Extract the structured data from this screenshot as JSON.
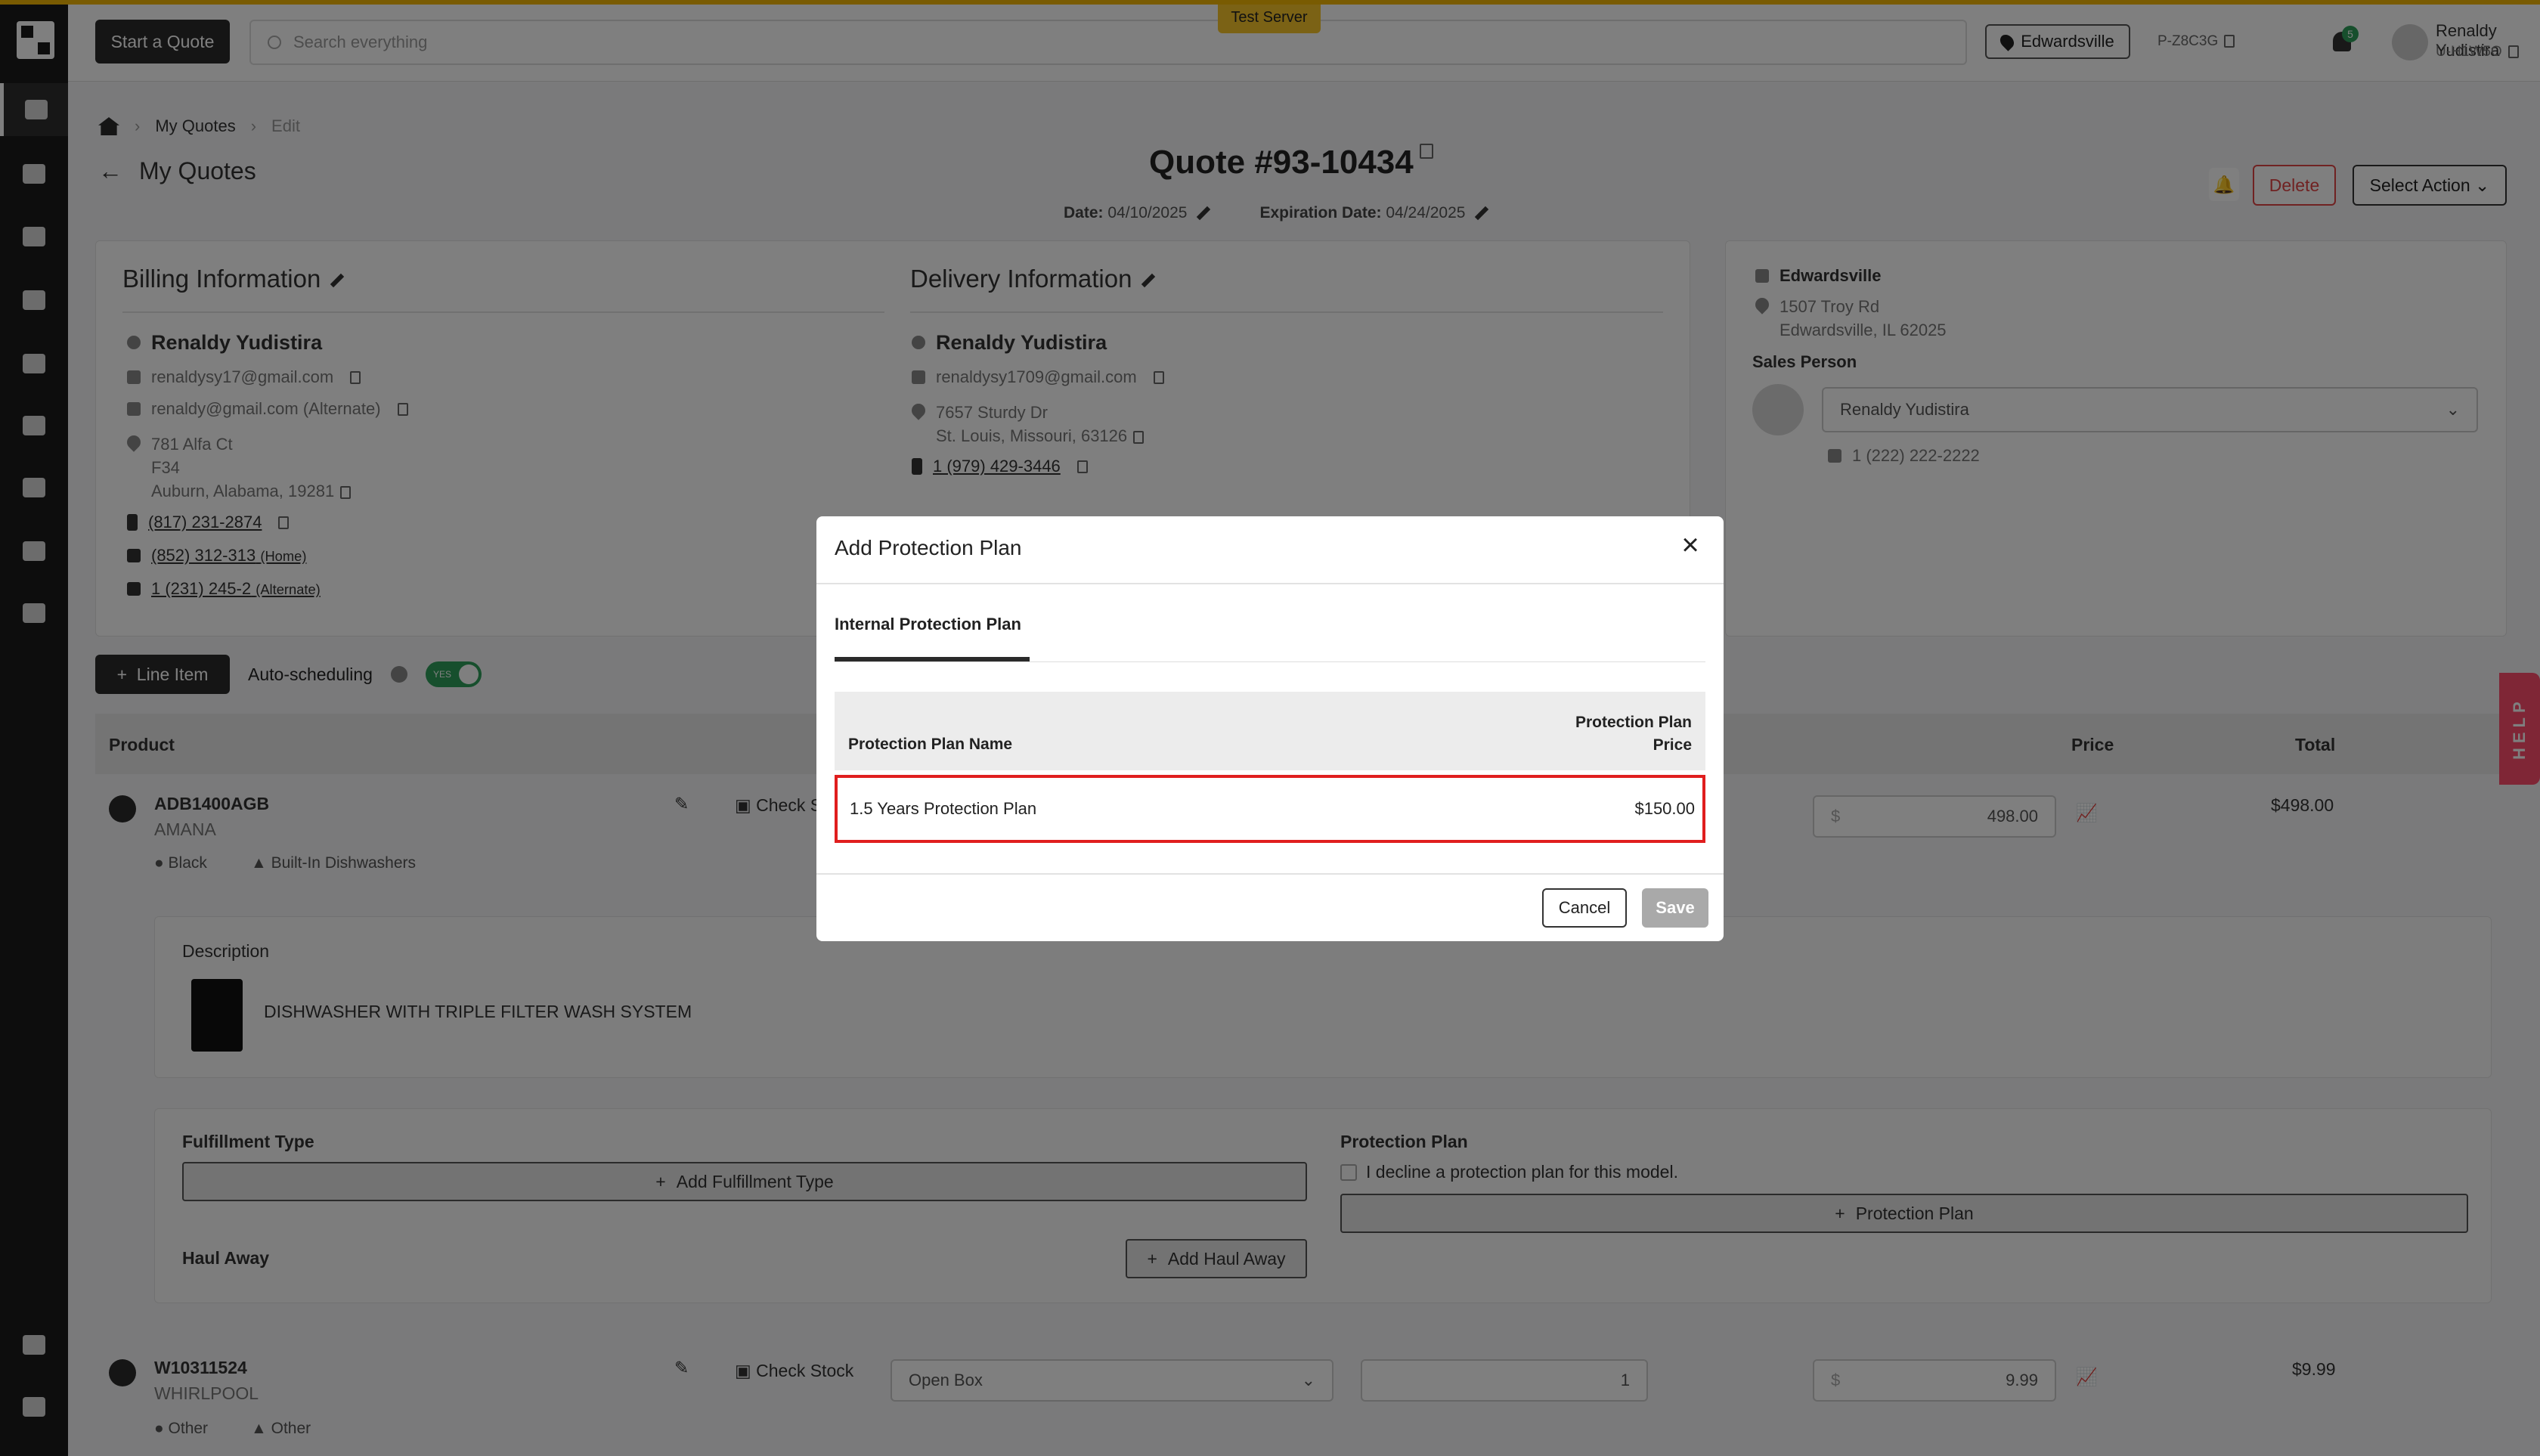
{
  "banner": {
    "test_server": "Test Server"
  },
  "header": {
    "start_quote": "Start a Quote",
    "search_placeholder": "Search everything",
    "location": "Edwardsville",
    "store_code": "P-Z8C3G",
    "notification_count": "5",
    "user_name": "Renaldy Yudistira",
    "user_id": "U-H1W5O"
  },
  "breadcrumb": {
    "home": "",
    "my_quotes": "My Quotes",
    "current": "Edit"
  },
  "page": {
    "back_label": "My Quotes",
    "quote_title": "Quote #93-10434",
    "date_label": "Date:",
    "date_value": "04/10/2025",
    "exp_label": "Expiration Date:",
    "exp_value": "04/24/2025",
    "delete_label": "Delete",
    "select_action_label": "Select Action"
  },
  "billing": {
    "title": "Billing Information",
    "name": "Renaldy Yudistira",
    "email": "renaldysy17@gmail.com",
    "email_alt": "renaldy@gmail.com (Alternate)",
    "address_line1": "781 Alfa Ct",
    "address_line2": "F34",
    "address_line3": "Auburn, Alabama, 19281",
    "mobile": "(817) 231-2874",
    "home_phone": "(852) 312-313",
    "home_suffix": "(Home)",
    "alt_phone": "1 (231) 245-2",
    "alt_suffix": "(Alternate)"
  },
  "delivery": {
    "title": "Delivery Information",
    "name": "Renaldy Yudistira",
    "email": "renaldysy1709@gmail.com",
    "address_line1": "7657 Sturdy Dr",
    "address_line2": "St. Louis, Missouri, 63126",
    "phone": "1 (979) 429-3446"
  },
  "store": {
    "name": "Edwardsville",
    "address_line1": "1507 Troy Rd",
    "address_line2": "Edwardsville, IL 62025",
    "sales_person_label": "Sales Person",
    "sales_person": "Renaldy Yudistira",
    "sales_phone": "1 (222) 222-2222"
  },
  "toolbar": {
    "line_item": "Line Item",
    "auto_scheduling": "Auto-scheduling",
    "toggle_text": "YES"
  },
  "table": {
    "headers": {
      "product": "Product",
      "price": "Price",
      "total": "Total"
    },
    "items": [
      {
        "sku": "ADB1400AGB",
        "brand": "AMANA",
        "color": "Black",
        "category": "Built-In Dishwashers",
        "check_stock": "Check Stock",
        "price": "498.00",
        "total": "$498.00",
        "description_label": "Description",
        "description": "DISHWASHER WITH TRIPLE FILTER WASH SYSTEM"
      },
      {
        "sku": "W10311524",
        "brand": "WHIRLPOOL",
        "color": "Other",
        "category": "Other",
        "check_stock": "Check Stock",
        "condition": "Open Box",
        "qty": "1",
        "price": "9.99",
        "total": "$9.99"
      }
    ],
    "currency_symbol": "$"
  },
  "fulfillment": {
    "label": "Fulfillment Type",
    "add_fulfillment": "Add Fulfillment Type",
    "haul_away_label": "Haul Away",
    "add_haul_away": "Add Haul Away",
    "protection_label": "Protection Plan",
    "decline_text": "I decline a protection plan for this model.",
    "protection_button": "Protection Plan"
  },
  "help": {
    "label": "HELP"
  },
  "modal": {
    "title": "Add Protection Plan",
    "tab": "Internal Protection Plan",
    "col_name": "Protection Plan Name",
    "col_price_line1": "Protection Plan",
    "col_price_line2": "Price",
    "plans": [
      {
        "name": "1.5 Years Protection Plan",
        "price": "$150.00"
      }
    ],
    "cancel": "Cancel",
    "save": "Save"
  },
  "colors": {
    "accent_dark": "#2a2a2a",
    "toggle_green": "#2e9e5b",
    "highlight_red": "#e01e1e",
    "delete_red": "#e04444",
    "help_pink": "#ff4d6d"
  }
}
